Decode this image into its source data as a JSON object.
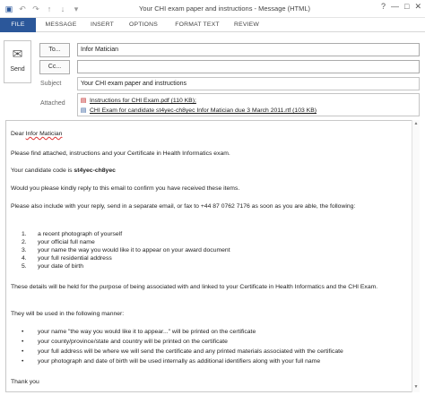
{
  "window": {
    "title": "Your CHI exam paper and instructions - Message (HTML)",
    "controls": [
      "?",
      "—",
      "□",
      "✕"
    ]
  },
  "qat": {
    "icons": [
      "save-icon",
      "undo-icon",
      "redo-icon",
      "up-arrow-icon",
      "down-arrow-icon",
      "customize-icon"
    ]
  },
  "ribbon": {
    "tabs": [
      "FILE",
      "MESSAGE",
      "INSERT",
      "OPTIONS",
      "FORMAT TEXT",
      "REVIEW"
    ]
  },
  "header": {
    "send_label": "Send",
    "to_button": "To...",
    "cc_button": "Cc...",
    "subject_label": "Subject",
    "attached_label": "Attached",
    "to_value": "Infor Matician",
    "cc_value": "",
    "subject_value": "Your CHI exam paper and instructions",
    "attachments": [
      {
        "name": "Instructions for CHI Exam.pdf (110 KB);",
        "type": "pdf"
      },
      {
        "name": "CHI Exam for candidate st4yec-ch8yec Infor Matician due 3 March 2011.rtf (103 KB)",
        "type": "rtf"
      }
    ]
  },
  "body": {
    "greeting_prefix": "Dear ",
    "greeting_name": "Infor Matician",
    "p1": "Please find attached, instructions and your Certificate in Health Informatics exam.",
    "code_prefix": "Your candidate code is ",
    "code_value": "st4yec-ch8yec",
    "p3": "Would you please kindly reply to this email to confirm you have received these items.",
    "p4": "Please also include with your reply, send in a separate email, or fax to +44 87 0762 7176 as soon as you are able, the following:",
    "numbered": [
      {
        "n": "1.",
        "t": "a recent photograph of yourself"
      },
      {
        "n": "2.",
        "t": "your official full name"
      },
      {
        "n": "3.",
        "t": "your name the way you would like it to appear on your award document"
      },
      {
        "n": "4.",
        "t": "your full residential address"
      },
      {
        "n": "5.",
        "t": "your date of birth"
      }
    ],
    "p5": "These details will be held for the purpose of being associated with and linked to your Certificate in Health Informatics and the CHI Exam.",
    "p6": "They will be used in the following manner:",
    "bullets": [
      "your name \"the way you would like it to appear...\" will be printed on the certificate",
      "your county/province/state and country will be printed on the certificate",
      "your full address will be where we will send the certificate and any printed materials associated with the certificate",
      "your photograph and date of birth will be used internally as additional identifiers along with your full name"
    ],
    "closing": "Thank you"
  }
}
